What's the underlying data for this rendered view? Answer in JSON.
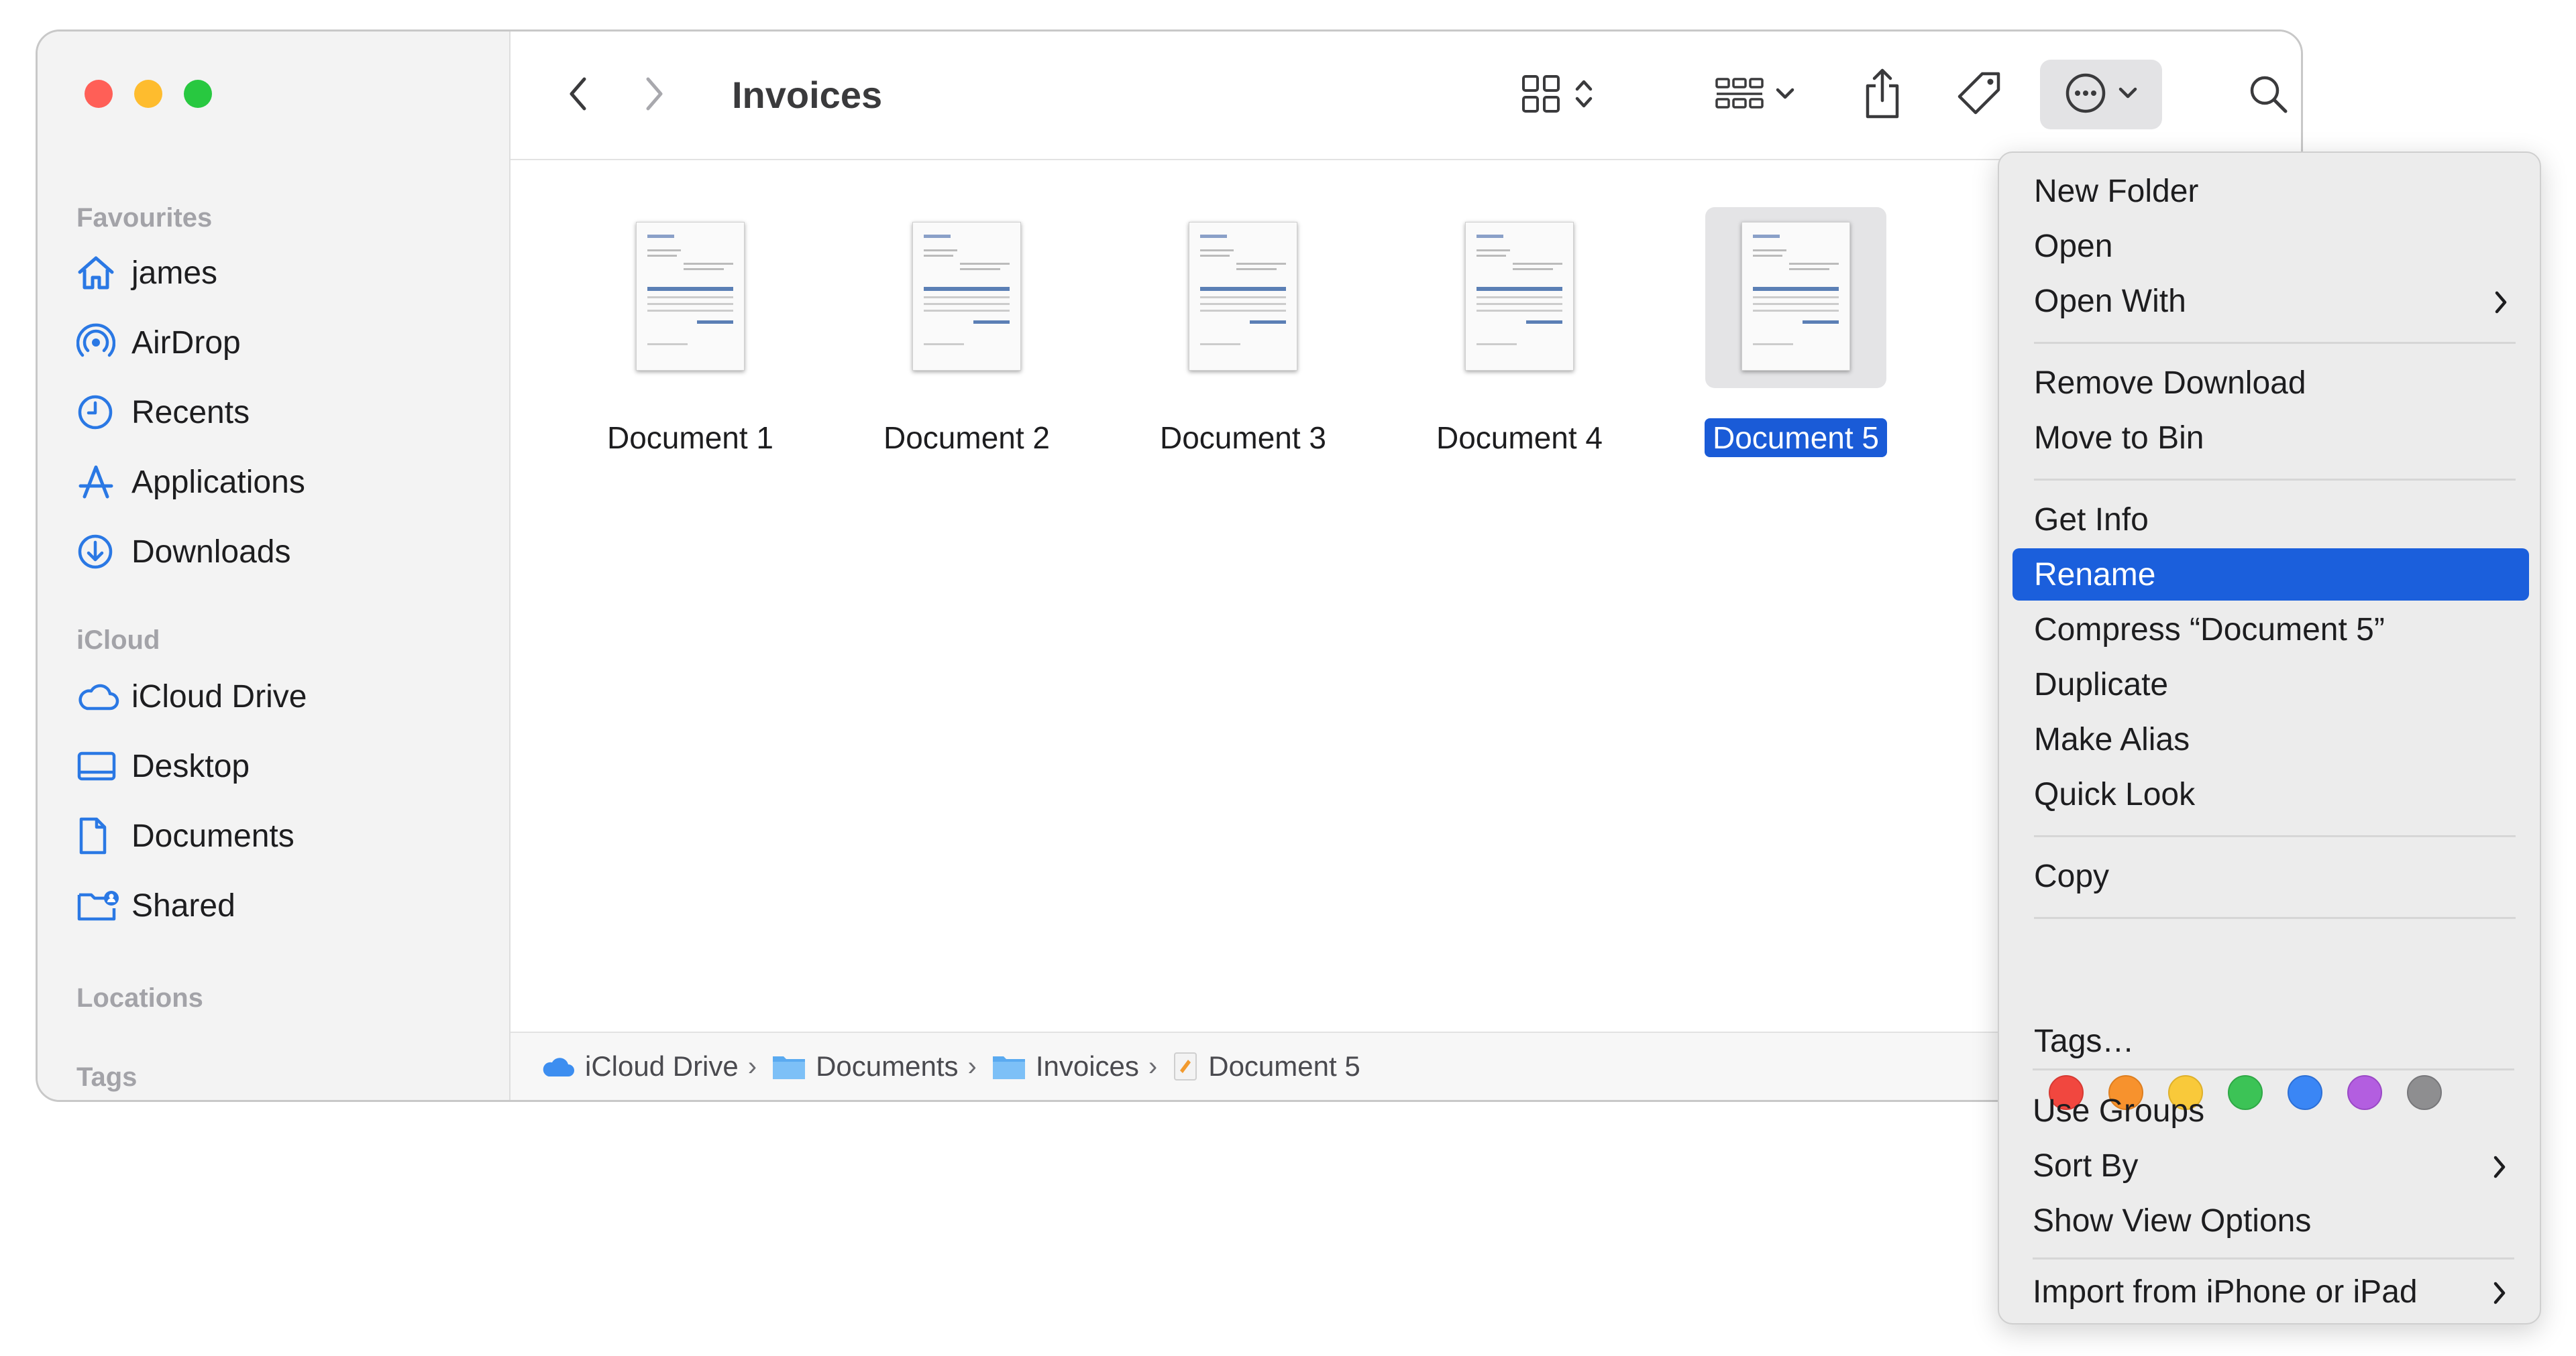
{
  "window": {
    "title": "Invoices"
  },
  "sidebar": {
    "sections": [
      {
        "title": "Favourites",
        "items": [
          {
            "label": "james",
            "icon": "house-icon"
          },
          {
            "label": "AirDrop",
            "icon": "airdrop-icon"
          },
          {
            "label": "Recents",
            "icon": "clock-icon"
          },
          {
            "label": "Applications",
            "icon": "applications-icon"
          },
          {
            "label": "Downloads",
            "icon": "download-icon"
          }
        ]
      },
      {
        "title": "iCloud",
        "items": [
          {
            "label": "iCloud Drive",
            "icon": "cloud-icon"
          },
          {
            "label": "Desktop",
            "icon": "desktop-icon"
          },
          {
            "label": "Documents",
            "icon": "document-icon"
          },
          {
            "label": "Shared",
            "icon": "shared-folder-icon"
          }
        ]
      },
      {
        "title": "Locations",
        "items": []
      },
      {
        "title": "Tags",
        "items": []
      }
    ]
  },
  "toolbar": {
    "back_icon": "chevron-left-icon",
    "forward_icon": "chevron-right-icon",
    "view_icon": "grid-view-icon",
    "group_icon": "group-icon",
    "share_icon": "share-icon",
    "tag_icon": "tag-icon",
    "action_icon": "ellipsis-circle-icon",
    "search_icon": "search-icon"
  },
  "files": [
    {
      "name": "Document 1",
      "selected": false
    },
    {
      "name": "Document 2",
      "selected": false
    },
    {
      "name": "Document 3",
      "selected": false
    },
    {
      "name": "Document 4",
      "selected": false
    },
    {
      "name": "Document 5",
      "selected": true
    }
  ],
  "pathbar": {
    "segments": [
      {
        "label": "iCloud Drive",
        "icon": "cloud-icon"
      },
      {
        "label": "Documents",
        "icon": "folder-icon"
      },
      {
        "label": "Invoices",
        "icon": "folder-icon"
      },
      {
        "label": "Document 5",
        "icon": "pages-document-icon"
      }
    ],
    "separator": "›"
  },
  "context_menu": {
    "items": {
      "new_folder": "New Folder",
      "open": "Open",
      "open_with": "Open With",
      "remove_download": "Remove Download",
      "move_to_bin": "Move to Bin",
      "get_info": "Get Info",
      "rename": "Rename",
      "compress": "Compress “Document 5”",
      "duplicate": "Duplicate",
      "make_alias": "Make Alias",
      "quick_look": "Quick Look",
      "copy": "Copy",
      "tags": "Tags…",
      "use_groups": "Use Groups",
      "sort_by": "Sort By",
      "show_view_options": "Show View Options",
      "import": "Import from iPhone or iPad"
    },
    "highlighted": "Rename",
    "tag_colors": [
      "#f1473f",
      "#f7922d",
      "#f9c93a",
      "#3cc356",
      "#3a86f5",
      "#b35ee0",
      "#8e8e90"
    ]
  },
  "colors": {
    "accent": "#1a5bd7",
    "traffic_red": "#ff5f57",
    "traffic_yellow": "#febc2e",
    "traffic_green": "#28c840",
    "sidebar_icon": "#2a78e4"
  }
}
